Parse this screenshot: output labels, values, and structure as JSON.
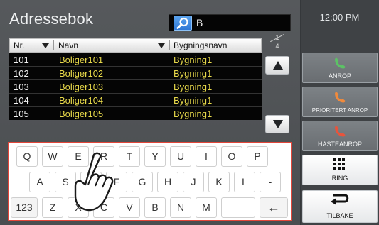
{
  "header": {
    "title": "Adressebok",
    "search_value": "B_",
    "clock": "12:00 PM"
  },
  "table": {
    "columns": [
      "Nr.",
      "Navn",
      "Bygningsnavn"
    ],
    "rows": [
      {
        "nr": "101",
        "navn": "Boliger101",
        "bygning": "Bygning1"
      },
      {
        "nr": "102",
        "navn": "Boliger102",
        "bygning": "Bygning1"
      },
      {
        "nr": "103",
        "navn": "Boliger103",
        "bygning": "Bygning1"
      },
      {
        "nr": "104",
        "navn": "Boliger104",
        "bygning": "Bygning1"
      },
      {
        "nr": "105",
        "navn": "Boliger105",
        "bygning": "Bygning1"
      }
    ]
  },
  "pagination": {
    "current": "1",
    "total": "4"
  },
  "side_buttons": {
    "anrop": "ANROP",
    "prioritert": "PRIORITERT ANROP",
    "haste": "HASTEANROP",
    "ring": "RING",
    "tilbake": "TILBAKE"
  },
  "keyboard": {
    "row1": [
      "Q",
      "W",
      "E",
      "R",
      "T",
      "Y",
      "U",
      "I",
      "O",
      "P"
    ],
    "row2": [
      "A",
      "S",
      "D",
      "F",
      "G",
      "H",
      "J",
      "K",
      "L",
      "-"
    ],
    "row3_mode": "123",
    "row3": [
      "Z",
      "X",
      "C",
      "V",
      "B",
      "N",
      "M"
    ],
    "space": "",
    "backspace": "←"
  },
  "colors": {
    "background": "#4c4f52",
    "name_text": "#e7d84a",
    "keyboard_highlight": "#e2463a",
    "phone_green": "#5cc265",
    "phone_orange": "#f08a3c",
    "phone_red": "#e8543c"
  },
  "icons": {
    "search": "magnifier-icon",
    "scroll_up": "triangle-up-icon",
    "scroll_down": "triangle-down-icon",
    "anrop": "phone-handset-icon",
    "ring": "keypad-grid-icon",
    "tilbake": "return-arrow-icon",
    "pointer": "pointing-hand-icon"
  }
}
